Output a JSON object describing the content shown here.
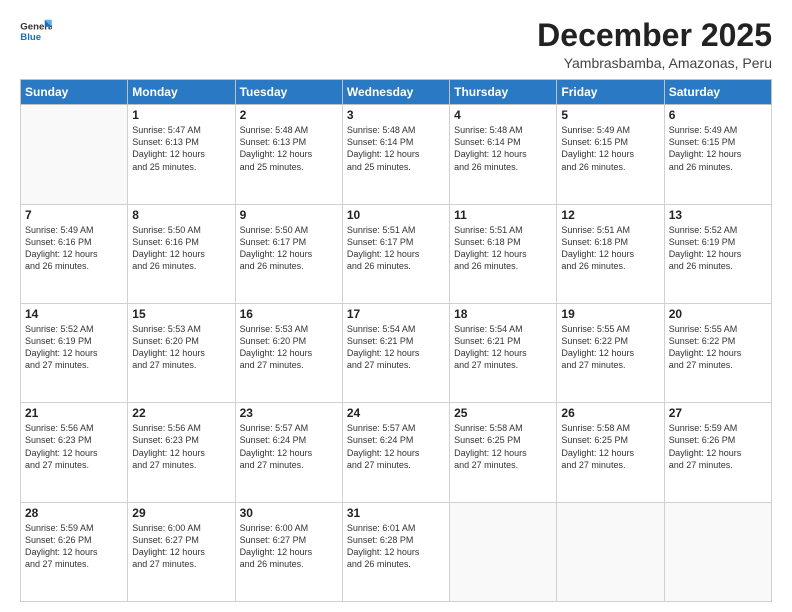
{
  "logo": {
    "line1": "General",
    "line2": "Blue"
  },
  "header": {
    "month": "December 2025",
    "location": "Yambrasbamba, Amazonas, Peru"
  },
  "weekdays": [
    "Sunday",
    "Monday",
    "Tuesday",
    "Wednesday",
    "Thursday",
    "Friday",
    "Saturday"
  ],
  "weeks": [
    [
      {
        "day": "",
        "info": ""
      },
      {
        "day": "1",
        "info": "Sunrise: 5:47 AM\nSunset: 6:13 PM\nDaylight: 12 hours\nand 25 minutes."
      },
      {
        "day": "2",
        "info": "Sunrise: 5:48 AM\nSunset: 6:13 PM\nDaylight: 12 hours\nand 25 minutes."
      },
      {
        "day": "3",
        "info": "Sunrise: 5:48 AM\nSunset: 6:14 PM\nDaylight: 12 hours\nand 25 minutes."
      },
      {
        "day": "4",
        "info": "Sunrise: 5:48 AM\nSunset: 6:14 PM\nDaylight: 12 hours\nand 26 minutes."
      },
      {
        "day": "5",
        "info": "Sunrise: 5:49 AM\nSunset: 6:15 PM\nDaylight: 12 hours\nand 26 minutes."
      },
      {
        "day": "6",
        "info": "Sunrise: 5:49 AM\nSunset: 6:15 PM\nDaylight: 12 hours\nand 26 minutes."
      }
    ],
    [
      {
        "day": "7",
        "info": "Sunrise: 5:49 AM\nSunset: 6:16 PM\nDaylight: 12 hours\nand 26 minutes."
      },
      {
        "day": "8",
        "info": "Sunrise: 5:50 AM\nSunset: 6:16 PM\nDaylight: 12 hours\nand 26 minutes."
      },
      {
        "day": "9",
        "info": "Sunrise: 5:50 AM\nSunset: 6:17 PM\nDaylight: 12 hours\nand 26 minutes."
      },
      {
        "day": "10",
        "info": "Sunrise: 5:51 AM\nSunset: 6:17 PM\nDaylight: 12 hours\nand 26 minutes."
      },
      {
        "day": "11",
        "info": "Sunrise: 5:51 AM\nSunset: 6:18 PM\nDaylight: 12 hours\nand 26 minutes."
      },
      {
        "day": "12",
        "info": "Sunrise: 5:51 AM\nSunset: 6:18 PM\nDaylight: 12 hours\nand 26 minutes."
      },
      {
        "day": "13",
        "info": "Sunrise: 5:52 AM\nSunset: 6:19 PM\nDaylight: 12 hours\nand 26 minutes."
      }
    ],
    [
      {
        "day": "14",
        "info": "Sunrise: 5:52 AM\nSunset: 6:19 PM\nDaylight: 12 hours\nand 27 minutes."
      },
      {
        "day": "15",
        "info": "Sunrise: 5:53 AM\nSunset: 6:20 PM\nDaylight: 12 hours\nand 27 minutes."
      },
      {
        "day": "16",
        "info": "Sunrise: 5:53 AM\nSunset: 6:20 PM\nDaylight: 12 hours\nand 27 minutes."
      },
      {
        "day": "17",
        "info": "Sunrise: 5:54 AM\nSunset: 6:21 PM\nDaylight: 12 hours\nand 27 minutes."
      },
      {
        "day": "18",
        "info": "Sunrise: 5:54 AM\nSunset: 6:21 PM\nDaylight: 12 hours\nand 27 minutes."
      },
      {
        "day": "19",
        "info": "Sunrise: 5:55 AM\nSunset: 6:22 PM\nDaylight: 12 hours\nand 27 minutes."
      },
      {
        "day": "20",
        "info": "Sunrise: 5:55 AM\nSunset: 6:22 PM\nDaylight: 12 hours\nand 27 minutes."
      }
    ],
    [
      {
        "day": "21",
        "info": "Sunrise: 5:56 AM\nSunset: 6:23 PM\nDaylight: 12 hours\nand 27 minutes."
      },
      {
        "day": "22",
        "info": "Sunrise: 5:56 AM\nSunset: 6:23 PM\nDaylight: 12 hours\nand 27 minutes."
      },
      {
        "day": "23",
        "info": "Sunrise: 5:57 AM\nSunset: 6:24 PM\nDaylight: 12 hours\nand 27 minutes."
      },
      {
        "day": "24",
        "info": "Sunrise: 5:57 AM\nSunset: 6:24 PM\nDaylight: 12 hours\nand 27 minutes."
      },
      {
        "day": "25",
        "info": "Sunrise: 5:58 AM\nSunset: 6:25 PM\nDaylight: 12 hours\nand 27 minutes."
      },
      {
        "day": "26",
        "info": "Sunrise: 5:58 AM\nSunset: 6:25 PM\nDaylight: 12 hours\nand 27 minutes."
      },
      {
        "day": "27",
        "info": "Sunrise: 5:59 AM\nSunset: 6:26 PM\nDaylight: 12 hours\nand 27 minutes."
      }
    ],
    [
      {
        "day": "28",
        "info": "Sunrise: 5:59 AM\nSunset: 6:26 PM\nDaylight: 12 hours\nand 27 minutes."
      },
      {
        "day": "29",
        "info": "Sunrise: 6:00 AM\nSunset: 6:27 PM\nDaylight: 12 hours\nand 27 minutes."
      },
      {
        "day": "30",
        "info": "Sunrise: 6:00 AM\nSunset: 6:27 PM\nDaylight: 12 hours\nand 26 minutes."
      },
      {
        "day": "31",
        "info": "Sunrise: 6:01 AM\nSunset: 6:28 PM\nDaylight: 12 hours\nand 26 minutes."
      },
      {
        "day": "",
        "info": ""
      },
      {
        "day": "",
        "info": ""
      },
      {
        "day": "",
        "info": ""
      }
    ]
  ]
}
